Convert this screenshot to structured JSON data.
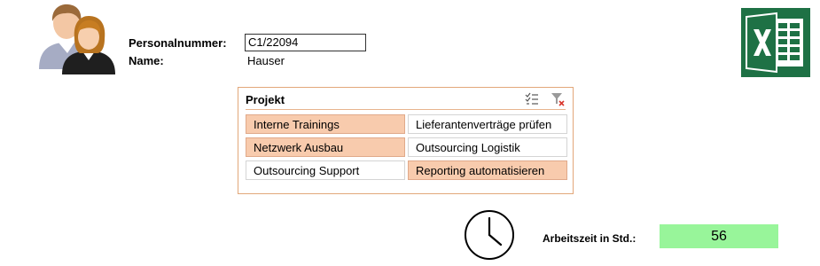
{
  "header": {
    "personalnummer_label": "Personalnummer:",
    "personalnummer_value": "C1/22094",
    "name_label": "Name:",
    "name_value": "Hauser",
    "user_icon": "people-icon",
    "app_icon": "excel-icon"
  },
  "slicer": {
    "title": "Projekt",
    "multi_select_icon": "multi-select-icon",
    "clear_filter_icon": "clear-filter-icon",
    "accent_color": "#f8cbad",
    "items": [
      {
        "label": "Interne Trainings",
        "selected": true
      },
      {
        "label": "Lieferantenverträge prüfen",
        "selected": false
      },
      {
        "label": "Netzwerk Ausbau",
        "selected": true
      },
      {
        "label": "Outsourcing Logistik",
        "selected": false
      },
      {
        "label": "Outsourcing Support",
        "selected": false
      },
      {
        "label": "Reporting automatisieren",
        "selected": true
      }
    ]
  },
  "summary": {
    "clock_icon": "clock-icon",
    "label": "Arbeitszeit in Std.:",
    "value": "56",
    "value_bg": "#98f59a"
  }
}
